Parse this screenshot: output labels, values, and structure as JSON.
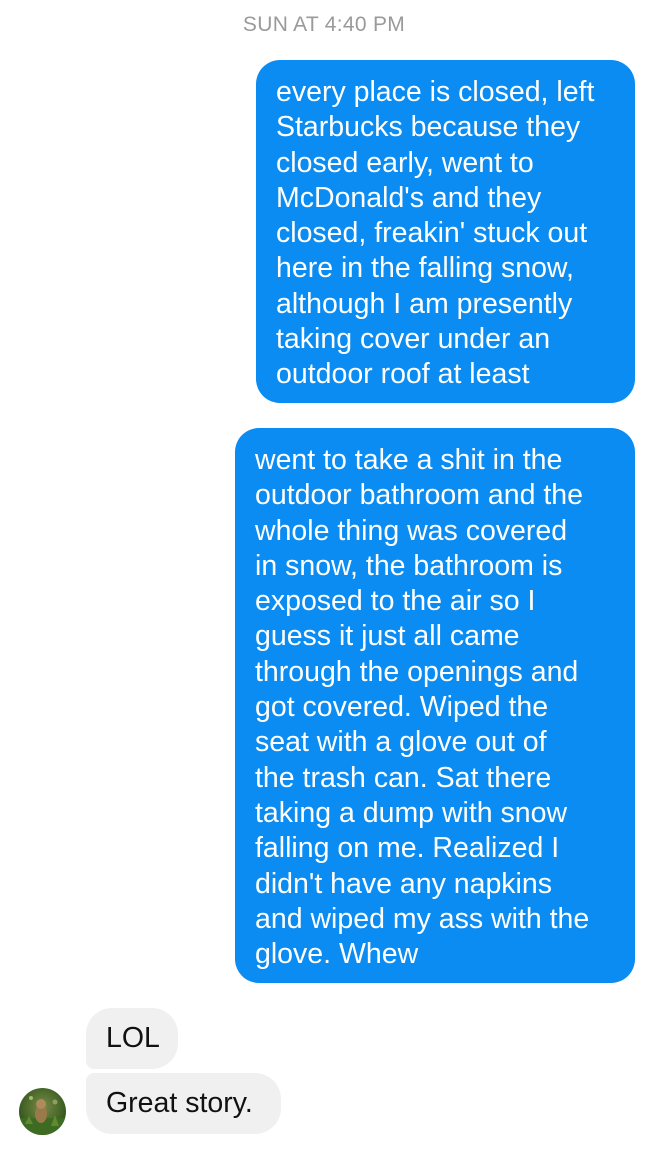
{
  "conversation": {
    "timestamp": "SUN AT 4:40 PM",
    "messages": [
      {
        "sender": "me",
        "lines": [
          "every place is closed, left",
          "Starbucks because they",
          "closed early, went to",
          "McDonald's and they",
          "closed, freakin' stuck out",
          "here in the falling snow,",
          "although I am presently",
          "taking cover under an",
          "outdoor roof at least"
        ]
      },
      {
        "sender": "me",
        "lines": [
          "went to take a shit in the",
          "outdoor bathroom and the",
          "whole thing was covered",
          "in snow, the bathroom is",
          "exposed to the air so I",
          "guess it just all came",
          "through the openings and",
          "got covered. Wiped the",
          "seat with a glove out of",
          "the trash can. Sat there",
          "taking a dump with snow",
          "falling on me. Realized I",
          "didn't have any napkins",
          "and wiped my ass with the",
          "glove. Whew"
        ]
      },
      {
        "sender": "them",
        "text": "LOL"
      },
      {
        "sender": "them",
        "text": "Great story."
      }
    ]
  },
  "colors": {
    "outgoing_bubble": "#0a8cf2",
    "incoming_bubble": "#f1f0f0",
    "timestamp_text": "#9a9a9a"
  },
  "icons": {
    "avatar": "contact-avatar-photo"
  }
}
